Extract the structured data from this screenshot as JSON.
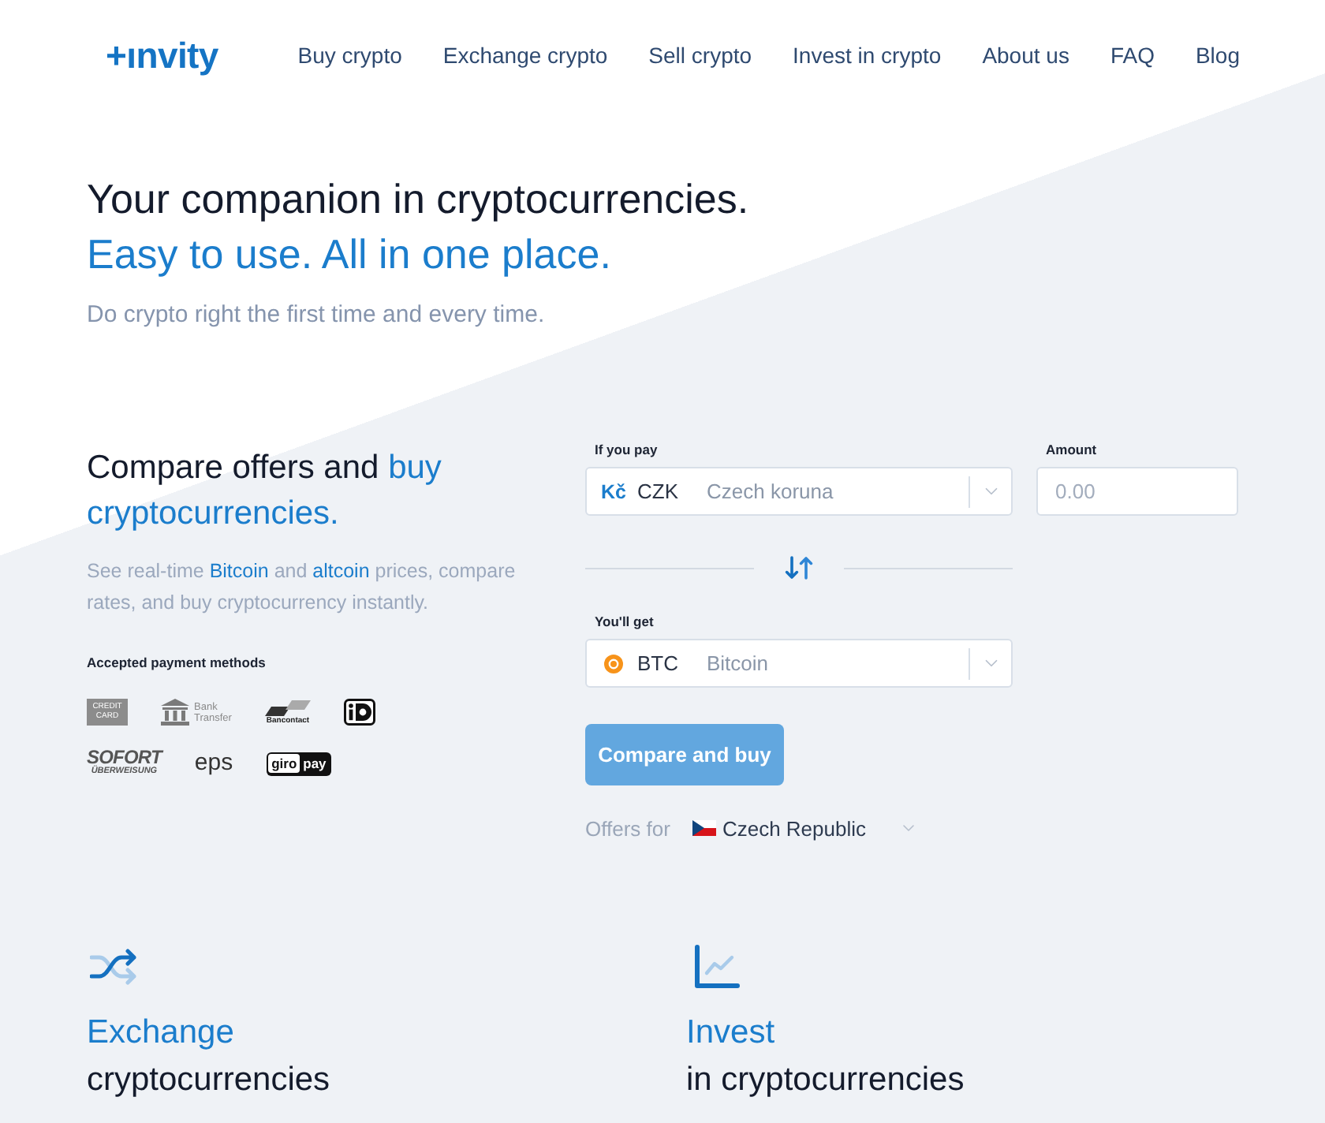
{
  "header": {
    "logo": "+ınvity",
    "nav": [
      {
        "label": "Buy crypto"
      },
      {
        "label": "Exchange crypto"
      },
      {
        "label": "Sell crypto"
      },
      {
        "label": "Invest in crypto"
      },
      {
        "label": "About us"
      },
      {
        "label": "FAQ"
      },
      {
        "label": "Blog"
      }
    ]
  },
  "hero": {
    "title": "Your companion in cryptocurrencies.",
    "tagline": "Easy to use. All in one place.",
    "subtitle": "Do crypto right the first time and every time."
  },
  "compare": {
    "heading": "Compare offers and",
    "heading_highlight": "buy cryptocurrencies.",
    "description": [
      {
        "kind": "text",
        "text": "See real-time "
      },
      {
        "kind": "link",
        "text": "Bitcoin"
      },
      {
        "kind": "text",
        "text": " and "
      },
      {
        "kind": "link",
        "text": "altcoin"
      },
      {
        "kind": "text",
        "text": " prices, compare rates, and buy cryptocurrency instantly."
      }
    ],
    "payment_title": "Accepted payment methods",
    "payment_methods": [
      {
        "kind": "card",
        "label": "CREDIT CARD"
      },
      {
        "kind": "bank",
        "label": "Bank Transfer"
      },
      {
        "kind": "bancontact",
        "label": "Bancontact"
      },
      {
        "kind": "ideal"
      },
      {
        "kind": "sofort",
        "label": "SOFORT",
        "sublabel": "ÜBERWEISUNG"
      },
      {
        "kind": "eps",
        "label": "eps"
      },
      {
        "kind": "giropay",
        "label": "giro",
        "label_2": "pay"
      }
    ]
  },
  "form": {
    "pay": {
      "label": "If you pay",
      "kind": "fiat",
      "symbol": "Kč",
      "code": "CZK",
      "name": "Czech koruna"
    },
    "amount": {
      "label": "Amount",
      "placeholder": "0.00"
    },
    "get": {
      "label": "You'll get",
      "kind": "crypto",
      "code": "BTC",
      "name": "Bitcoin"
    },
    "submit": "Compare and buy",
    "offers": {
      "label": "Offers for",
      "country": "Czech Republic"
    }
  },
  "features": [
    {
      "kind": "exchange",
      "title": "Exchange",
      "subtitle": "cryptocurrencies"
    },
    {
      "kind": "invest",
      "title": "Invest",
      "subtitle": "in cryptocurrencies"
    }
  ]
}
